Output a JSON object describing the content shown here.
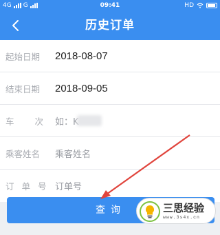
{
  "status": {
    "carrier_left": "4G",
    "carrier_right": "G",
    "time": "09:41",
    "hd": "HD"
  },
  "nav": {
    "title": "历史订单",
    "back_icon": "chevron-left-icon"
  },
  "form": {
    "start_date": {
      "label": "起始日期",
      "value": "2018-08-07"
    },
    "end_date": {
      "label": "结束日期",
      "value": "2018-09-05"
    },
    "train_no": {
      "label": "车次",
      "placeholder": "如：K"
    },
    "passenger": {
      "label": "乘客姓名",
      "placeholder": "乘客姓名"
    },
    "order_no": {
      "label": "订单号",
      "placeholder": "订单号"
    }
  },
  "query_button": {
    "label": "查询"
  },
  "watermark": {
    "name": "三思经验",
    "site": "www.3s4x.cn"
  },
  "colors": {
    "primary": "#3a8ef0",
    "arrow": "#e0443c"
  }
}
